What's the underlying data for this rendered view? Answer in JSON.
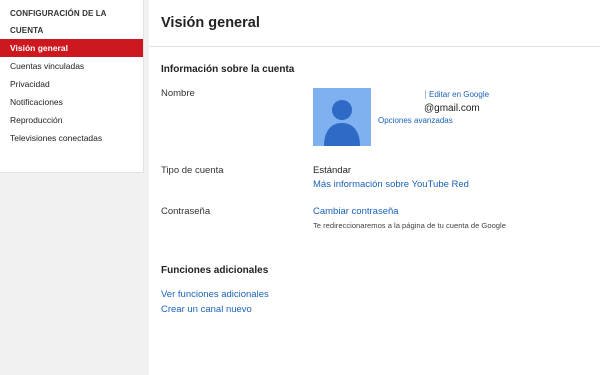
{
  "sidebar": {
    "title": "CONFIGURACIÓN DE LA CUENTA",
    "items": [
      {
        "label": "Visión general",
        "active": true
      },
      {
        "label": "Cuentas vinculadas",
        "active": false
      },
      {
        "label": "Privacidad",
        "active": false
      },
      {
        "label": "Notificaciones",
        "active": false
      },
      {
        "label": "Reproducción",
        "active": false
      },
      {
        "label": "Televisiones conectadas",
        "active": false
      }
    ]
  },
  "main": {
    "title": "Visión general",
    "account_section": {
      "title": "Información sobre la cuenta",
      "name_label": "Nombre",
      "edit_google_link": "Editar en Google",
      "email": "@gmail.com",
      "advanced_options_link": "Opciones avanzadas",
      "account_type_label": "Tipo de cuenta",
      "account_type_value": "Estándar",
      "youtube_red_link": "Más información sobre YouTube Red",
      "password_label": "Contraseña",
      "change_password_link": "Cambiar contraseña",
      "redirect_note": "Te redireccionaremos a la página de tu cuenta de Google"
    },
    "additional_section": {
      "title": "Funciones adicionales",
      "view_features_link": "Ver funciones adicionales",
      "create_channel_link": "Crear un canal nuevo"
    }
  },
  "colors": {
    "accent_red": "#cc181e",
    "link_blue": "#1c62b9",
    "avatar_bg": "#7fb0f0",
    "avatar_figure": "#2f6ac6"
  },
  "icons": {
    "avatar": "user-silhouette-icon"
  }
}
